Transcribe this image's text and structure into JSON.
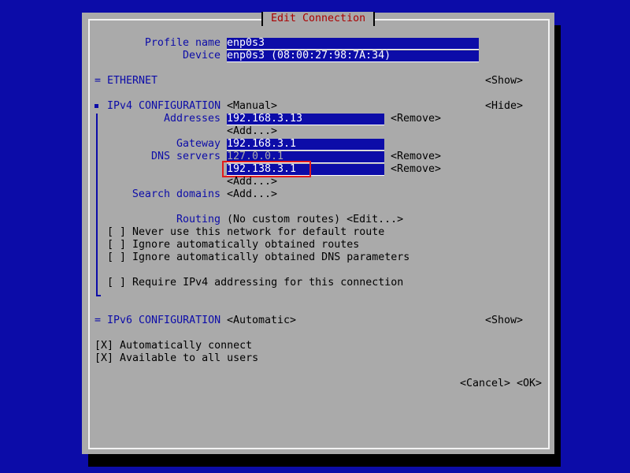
{
  "dialog": {
    "title": "Edit Connection"
  },
  "profile": {
    "name_label": "Profile name",
    "name_value": "enp0s3",
    "device_label": "Device",
    "device_value": "enp0s3 (08:00:27:98:7A:34)"
  },
  "ethernet": {
    "header": "= ETHERNET",
    "toggle": "<Show>"
  },
  "ipv4": {
    "header": "IPv4 CONFIGURATION",
    "method": "<Manual>",
    "toggle": "<Hide>",
    "addresses_label": "Addresses",
    "addresses": [
      "192.168.3.13"
    ],
    "add": "<Add...>",
    "remove": "<Remove>",
    "gateway_label": "Gateway",
    "gateway": "192.168.3.1",
    "dns_label": "DNS servers",
    "dns": [
      "127.0.0.1",
      "192.138.3.1"
    ],
    "search_label": "Search domains",
    "routing_label": "Routing",
    "routing_value": "(No custom routes) <Edit...>",
    "options": [
      "[ ] Never use this network for default route",
      "[ ] Ignore automatically obtained routes",
      "[ ] Ignore automatically obtained DNS parameters"
    ],
    "require": "[ ] Require IPv4 addressing for this connection"
  },
  "ipv6": {
    "header": "= IPv6 CONFIGURATION",
    "method": "<Automatic>",
    "toggle": "<Show>"
  },
  "general": {
    "auto_connect": "[X] Automatically connect",
    "all_users": "[X] Available to all users"
  },
  "buttons": {
    "cancel": "<Cancel>",
    "ok": "<OK>"
  },
  "colors": {
    "background": "#0c0ca8",
    "dialog": "#aaaaaa",
    "title": "#aa0000",
    "highlight": "#e21c1c"
  }
}
